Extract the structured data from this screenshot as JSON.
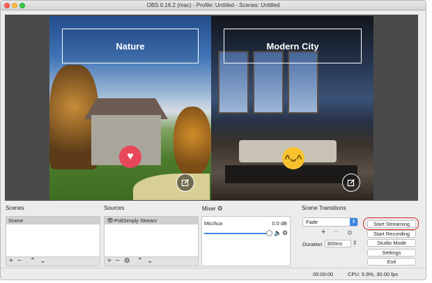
{
  "window": {
    "title": "OBS 0.16.2 (mac) - Profile: Untitled - Scenes: Untitled"
  },
  "preview": {
    "left_label": "Nature",
    "right_label": "Modern City",
    "left_emoji": "heart",
    "right_emoji": "laughing-face"
  },
  "scenes": {
    "title": "Scenes",
    "items": [
      "Scene"
    ]
  },
  "sources": {
    "title": "Sources",
    "items": [
      "PollSimply Stream"
    ]
  },
  "mixer": {
    "title": "Mixer",
    "channel": "Mic/Aux",
    "level": "0.0 dB",
    "volume_fraction": 1.0
  },
  "transitions": {
    "title": "Scene Transitions",
    "selected": "Fade",
    "duration_label": "Duration",
    "duration_value": "300ms"
  },
  "controls": {
    "start_streaming": "Start Streaming",
    "start_recording": "Start Recording",
    "studio_mode": "Studio Mode",
    "settings": "Settings",
    "exit": "Exit"
  },
  "status": {
    "time": "00:00:00",
    "cpu": "CPU: 5.9%, 30.00 fps"
  },
  "colors": {
    "accent": "#3d86e6",
    "highlight": "#d0261f",
    "heart": "#e8475a",
    "laugh": "#f8c22e"
  }
}
